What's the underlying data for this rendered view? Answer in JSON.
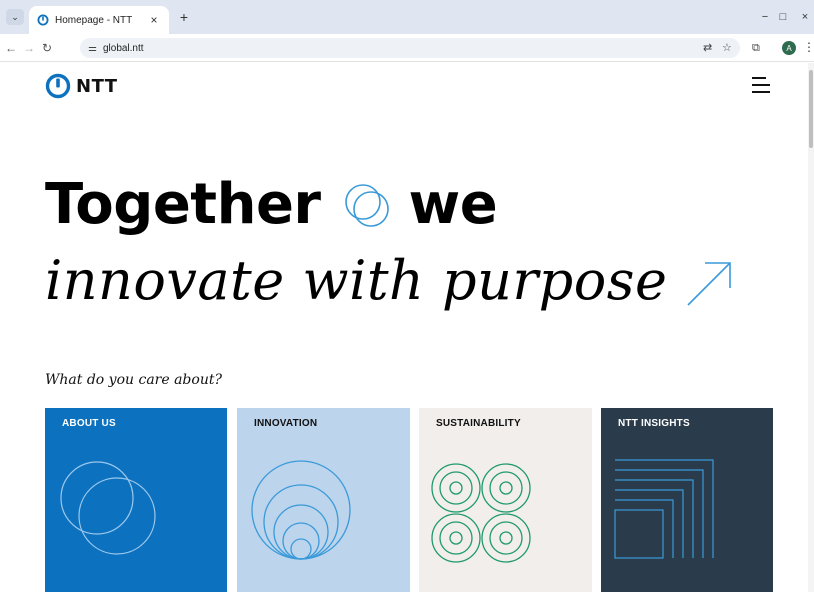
{
  "browser": {
    "tab_title": "Homepage - NTT",
    "tab_close": "×",
    "new_tab": "+",
    "url": "global.ntt",
    "controls": {
      "minimize": "−",
      "maximize": "□",
      "close": "×"
    },
    "profile_initial": "A"
  },
  "header": {
    "logo_text": "NTT"
  },
  "hero": {
    "line1_word1": "Together",
    "line1_word2": "we",
    "line2": "innovate with purpose"
  },
  "question": "What do you care about?",
  "cards": [
    {
      "title": "ABOUT US",
      "bg": "#0c72c0",
      "fg": "#ffffff",
      "icon": "overlapping-circles-icon"
    },
    {
      "title": "INNOVATION",
      "bg": "#bcd4ec",
      "fg": "#111111",
      "icon": "nested-circles-icon"
    },
    {
      "title": "SUSTAINABILITY",
      "bg": "#f1eeeb",
      "fg": "#111111",
      "icon": "concentric-grid-icon"
    },
    {
      "title": "NTT INSIGHTS",
      "bg": "#2a3b4c",
      "fg": "#ffffff",
      "icon": "nested-squares-icon"
    }
  ],
  "colors": {
    "brand_blue": "#0c72c0",
    "accent_line": "#3a9ad9",
    "green_line": "#1f9a6a"
  }
}
